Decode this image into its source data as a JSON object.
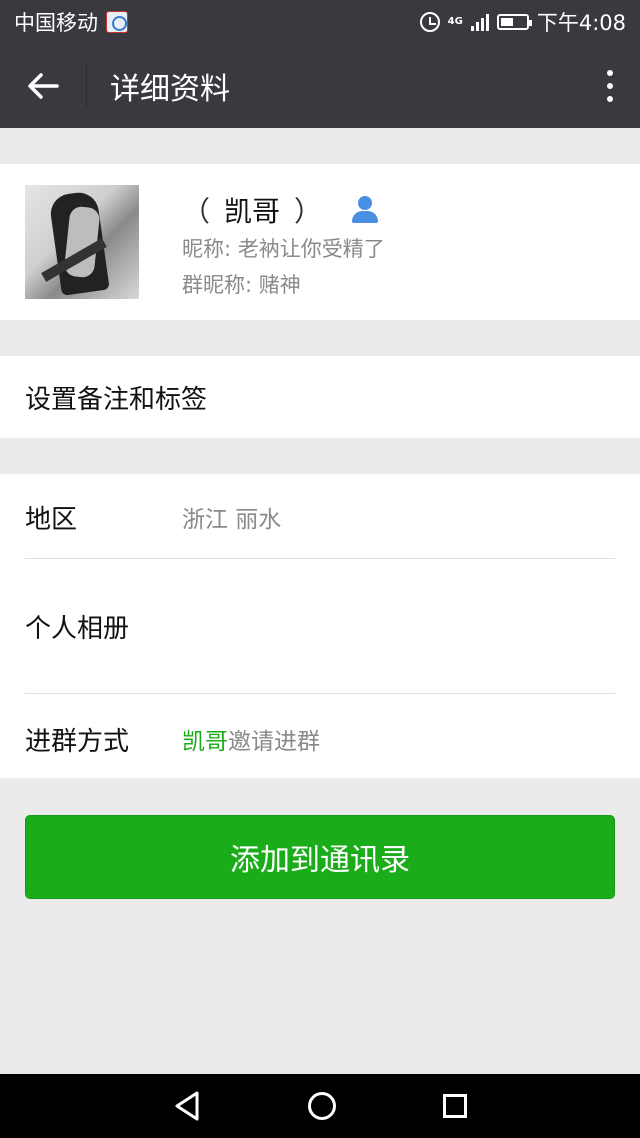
{
  "status_bar": {
    "carrier": "中国移动",
    "network": "4G",
    "time": "下午4:08",
    "battery_level": 0.5
  },
  "header": {
    "title": "详细资料"
  },
  "profile": {
    "name_open_paren": "（",
    "name": "凯哥",
    "name_close_paren": "）",
    "nickname": "昵称: 老衲让你受精了",
    "group_nickname": "群昵称: 赌神"
  },
  "remark": {
    "label": "设置备注和标签"
  },
  "info": {
    "region_label": "地区",
    "region_value": "浙江  丽水",
    "album_label": "个人相册",
    "join_label": "进群方式",
    "join_inviter": "凯哥",
    "join_suffix": "邀请进群"
  },
  "actions": {
    "add_contact": "添加到通讯录"
  },
  "colors": {
    "header_bg": "#393a3f",
    "accent_green": "#1aad19",
    "page_bg": "#ebebeb",
    "verified_blue": "#4a90e2"
  }
}
